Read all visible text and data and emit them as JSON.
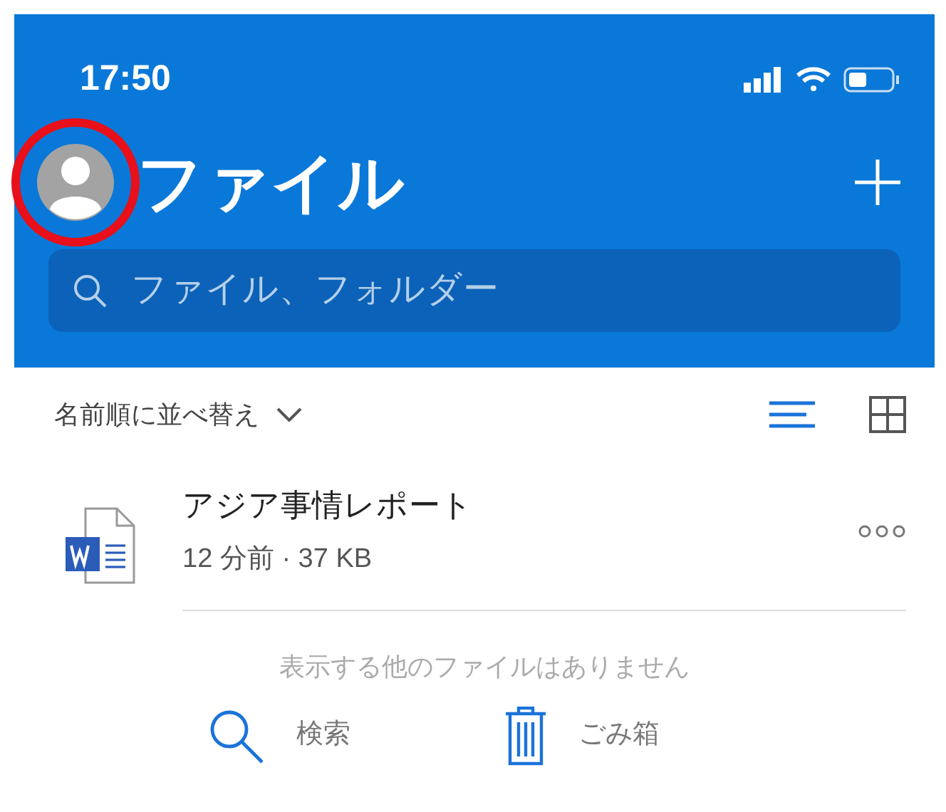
{
  "status_bar": {
    "time": "17:50"
  },
  "header": {
    "title": "ファイル",
    "avatar_highlighted": true,
    "search": {
      "placeholder": "ファイル、フォルダー"
    }
  },
  "sort": {
    "label": "名前順に並べ替え"
  },
  "view_toggles": [
    {
      "kind": "list",
      "selected": true
    },
    {
      "kind": "grid",
      "selected": false
    }
  ],
  "files": [
    {
      "kind": "word",
      "name": "アジア事情レポート",
      "meta": "12 分前 · 37 KB"
    }
  ],
  "empty_message": "表示する他のファイルはありません",
  "actions": [
    {
      "kind": "search",
      "label": "検索"
    },
    {
      "kind": "trash",
      "label": "ごみ箱"
    }
  ]
}
